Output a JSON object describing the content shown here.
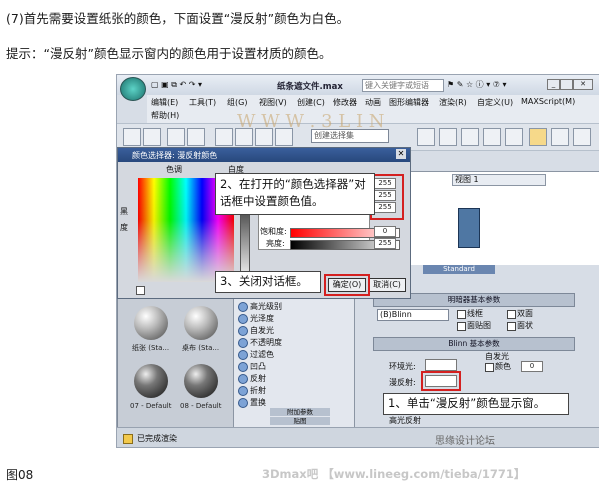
{
  "article": {
    "step_text": "(7)首先需要设置纸张的颜色，下面设置“漫反射”颜色为白色。",
    "tip_text": "提示：“漫反射”颜色显示窗内的颜色用于设置材质的颜色。",
    "figure_label": "图08",
    "footer_watermark": "3Dmax吧 【www.lineeg.com/tieba/1771】"
  },
  "app": {
    "title": "纸条遮文件.max",
    "search_placeholder": "键入关键字或短语",
    "menu": [
      "编辑(E)",
      "工具(T)",
      "组(G)",
      "视图(V)",
      "创建(C)",
      "修改器",
      "动画",
      "图形编辑器",
      "渲染(R)",
      "自定义(U)",
      "MAXScript(M)",
      "帮助(H)"
    ],
    "selection_set_placeholder": "创建选择集",
    "status_text": "已完成渲染",
    "viewport_label": "视图 1"
  },
  "color_selector": {
    "title": "颜色选择器: 漫反射颜色",
    "labels": {
      "hue": "色调",
      "whiteness": "白度",
      "blackness": "黑",
      "degree": "度",
      "saturation": "饱和度:",
      "value": "亮度:"
    },
    "rgb_values": [
      "255",
      "255",
      "255"
    ],
    "saturation_value": "0",
    "brightness_value": "255",
    "ok_button": "确定(O)",
    "cancel_button": "取消(C)"
  },
  "material_editor": {
    "standard_label": "Standard",
    "shader_rollout": "明暗器基本参数",
    "shader_value": "(B)Blinn",
    "options": [
      "线框",
      "双面",
      "面贴图",
      "面状"
    ],
    "blinn_rollout": "Blinn 基本参数",
    "self_illum": "自发光",
    "color_label": "颜色",
    "self_illum_value": "0",
    "ambient_label": "环境光:",
    "diffuse_label": "漫反射:",
    "specular_label": "高光反射",
    "samples": [
      {
        "label": "纸张 (Sta..."
      },
      {
        "label": "桌布 (Sta..."
      },
      {
        "label": "07 - Default"
      },
      {
        "label": "08 - Default"
      }
    ],
    "nav_items": [
      "高光级别",
      "光泽度",
      "自发光",
      "不透明度",
      "过滤色",
      "凹凸",
      "反射",
      "折射",
      "置换",
      "附加参数",
      "贴图"
    ]
  },
  "callouts": {
    "step2": "2、在打开的“颜色选择器”对话框中设置颜色值。",
    "step3": "3、关闭对话框。",
    "step1": "1、单击“漫反射”颜色显示窗。"
  },
  "watermarks": {
    "center": "W W W . 3 L I N",
    "bottom": "思缘设计论坛 www.MISSYUAN.COM"
  },
  "colors": {
    "accent_red": "#d42020",
    "title_blue": "#2c4f86",
    "swatch": "#4f77a3"
  }
}
